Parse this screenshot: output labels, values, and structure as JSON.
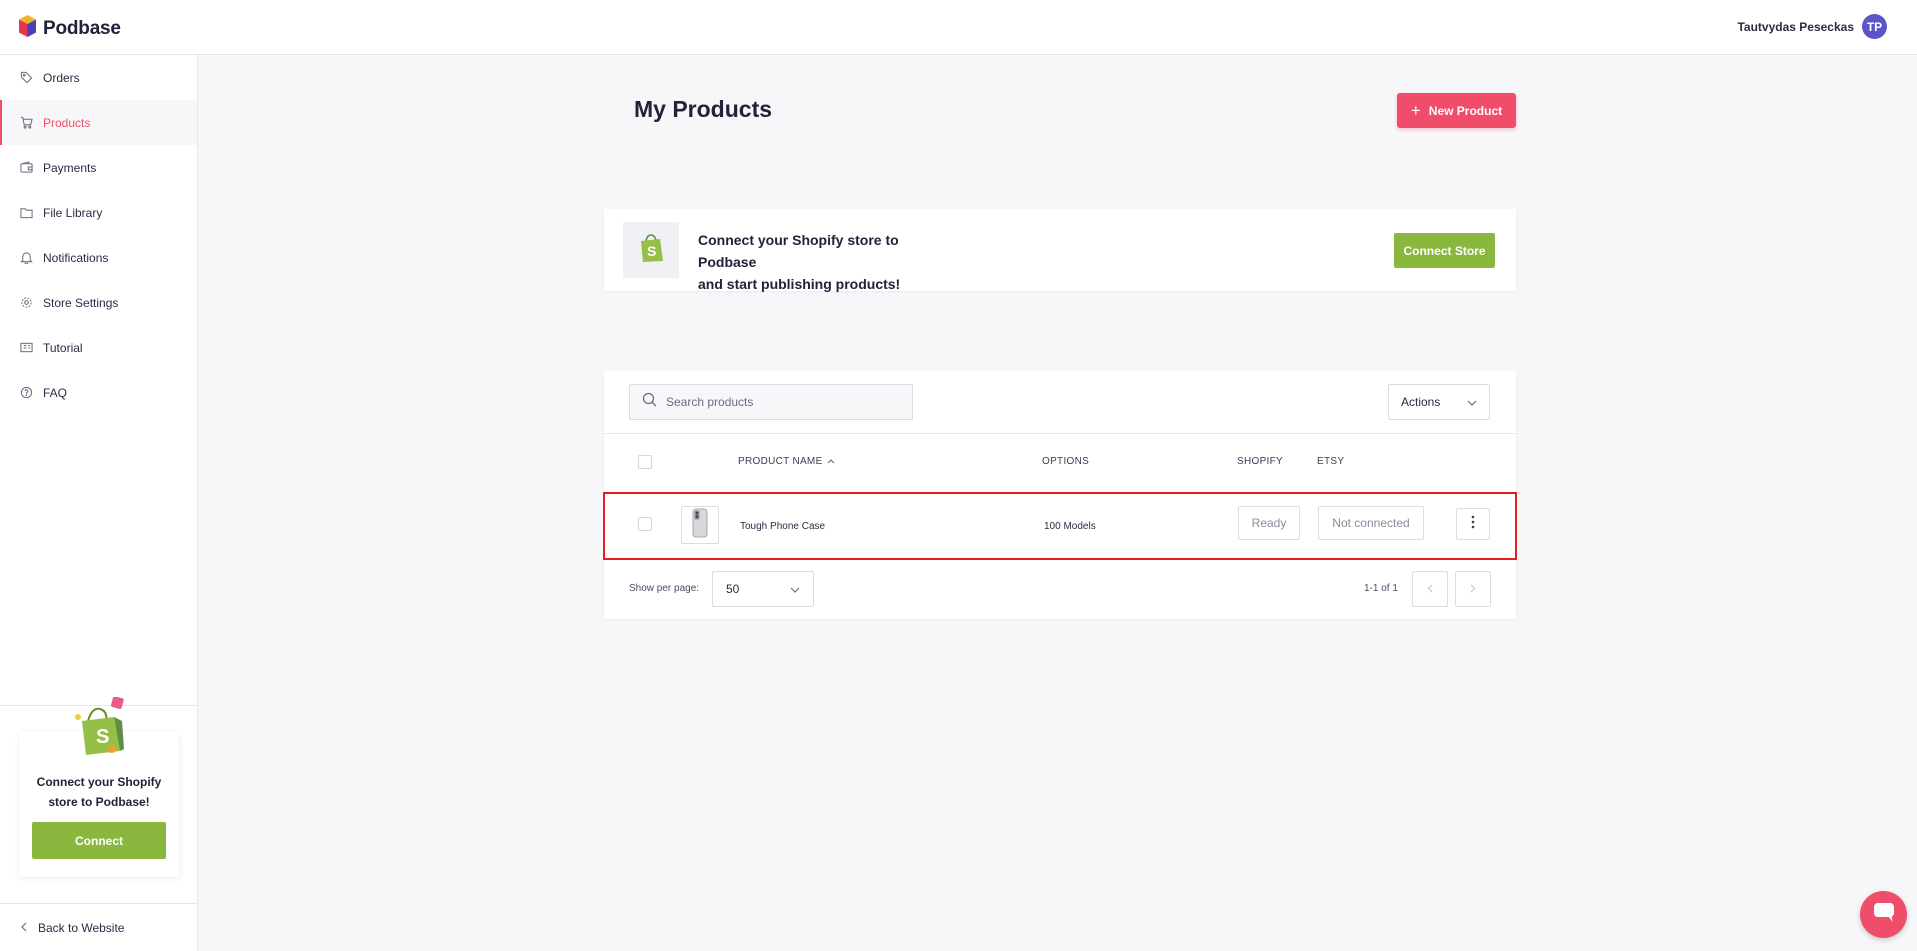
{
  "app": {
    "name": "Podbase",
    "user_name": "Tautvydas Peseckas",
    "user_initials": "TP"
  },
  "sidebar": {
    "items": [
      {
        "label": "Orders",
        "icon": "tag-icon"
      },
      {
        "label": "Products",
        "icon": "cart-icon",
        "active": true
      },
      {
        "label": "Payments",
        "icon": "wallet-icon"
      },
      {
        "label": "File Library",
        "icon": "folder-icon"
      },
      {
        "label": "Notifications",
        "icon": "bell-icon"
      },
      {
        "label": "Store Settings",
        "icon": "gear-icon"
      },
      {
        "label": "Tutorial",
        "icon": "book-icon"
      },
      {
        "label": "FAQ",
        "icon": "help-circle-icon"
      }
    ],
    "promo_line1": "Connect your Shopify",
    "promo_line2": "store to Podbase!",
    "promo_button": "Connect",
    "back_link": "Back to Website"
  },
  "main": {
    "title": "My Products",
    "new_product_button": "New Product",
    "connect_card": {
      "line1": "Connect your Shopify store to Podbase",
      "line2": "and start publishing products!",
      "button": "Connect Store"
    },
    "table": {
      "search_placeholder": "Search products",
      "actions_label": "Actions",
      "columns": {
        "product_name": "PRODUCT NAME",
        "options": "OPTIONS",
        "shopify": "SHOPIFY",
        "etsy": "ETSY"
      },
      "rows": [
        {
          "name": "Tough Phone Case",
          "options": "100 Models",
          "shopify_status": "Ready",
          "etsy_status": "Not connected"
        }
      ],
      "per_page_label": "Show per page:",
      "per_page_value": "50",
      "range_text": "1-1 of 1"
    }
  },
  "colors": {
    "accent": "#f04d6a",
    "shopify_green": "#8ab83f",
    "avatar": "#5b55c8",
    "highlight_border": "#e81c1c"
  }
}
